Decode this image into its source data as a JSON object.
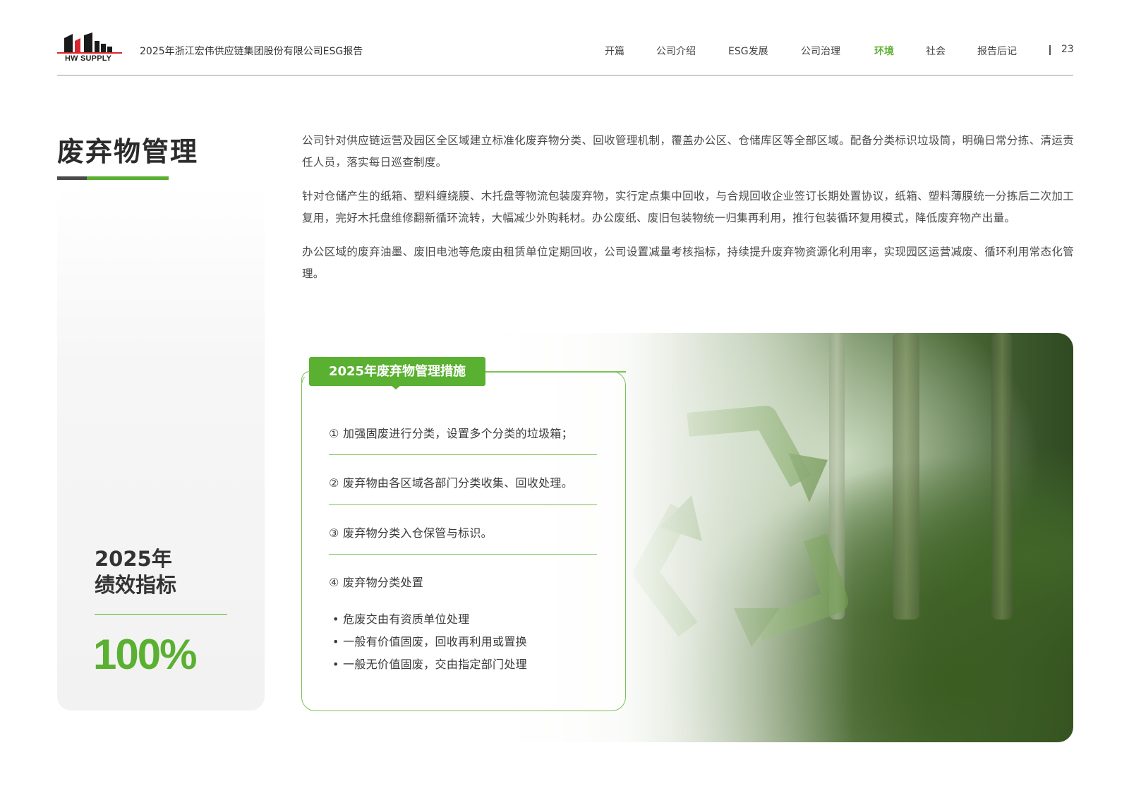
{
  "header": {
    "logo_text": "HW SUPPLY",
    "doc_title": "2025年浙江宏伟供应链集团股份有限公司ESG报告",
    "nav": [
      "开篇",
      "公司介绍",
      "ESG发展",
      "公司治理",
      "环境",
      "社会",
      "报告后记"
    ],
    "active_nav": "环境",
    "page_number": "23"
  },
  "section": {
    "title": "废弃物管理",
    "paragraphs": [
      "公司针对供应链运营及园区全区域建立标准化废弃物分类、回收管理机制，覆盖办公区、仓储库区等全部区域。配备分类标识垃圾筒，明确日常分拣、清运责任人员，落实每日巡查制度。",
      "针对仓储产生的纸箱、塑料缠绕膜、木托盘等物流包装废弃物，实行定点集中回收，与合规回收企业签订长期处置协议，纸箱、塑料薄膜统一分拣后二次加工复用，完好木托盘维修翻新循环流转，大幅减少外购耗材。办公废纸、废旧包装物统一归集再利用，推行包装循环复用模式，降低废弃物产出量。",
      "办公区域的废弃油墨、废旧电池等危废由租赁单位定期回收，公司设置减量考核指标，持续提升废弃物资源化利用率，实现园区运营减废、循环利用常态化管理。"
    ]
  },
  "kpi": {
    "year": "2025年",
    "label": "绩效指标",
    "value": "100%"
  },
  "measures": {
    "tag": "2025年废弃物管理措施",
    "items": [
      "① 加强固废进行分类，设置多个分类的垃圾箱；",
      "② 废弃物由各区域各部门分类收集、回收处理。",
      "③ 废弃物分类入仓保管与标识。",
      "④ 废弃物分类处置"
    ],
    "sub_items": [
      "• 危废交由有资质单位处理",
      "• 一般有价值固废，回收再利用或置换",
      "• 一般无价值固废，交由指定部门处理"
    ]
  },
  "colors": {
    "accent_green": "#5ab031",
    "text_dark": "#3a3a3a",
    "logo_red": "#d9262c"
  }
}
